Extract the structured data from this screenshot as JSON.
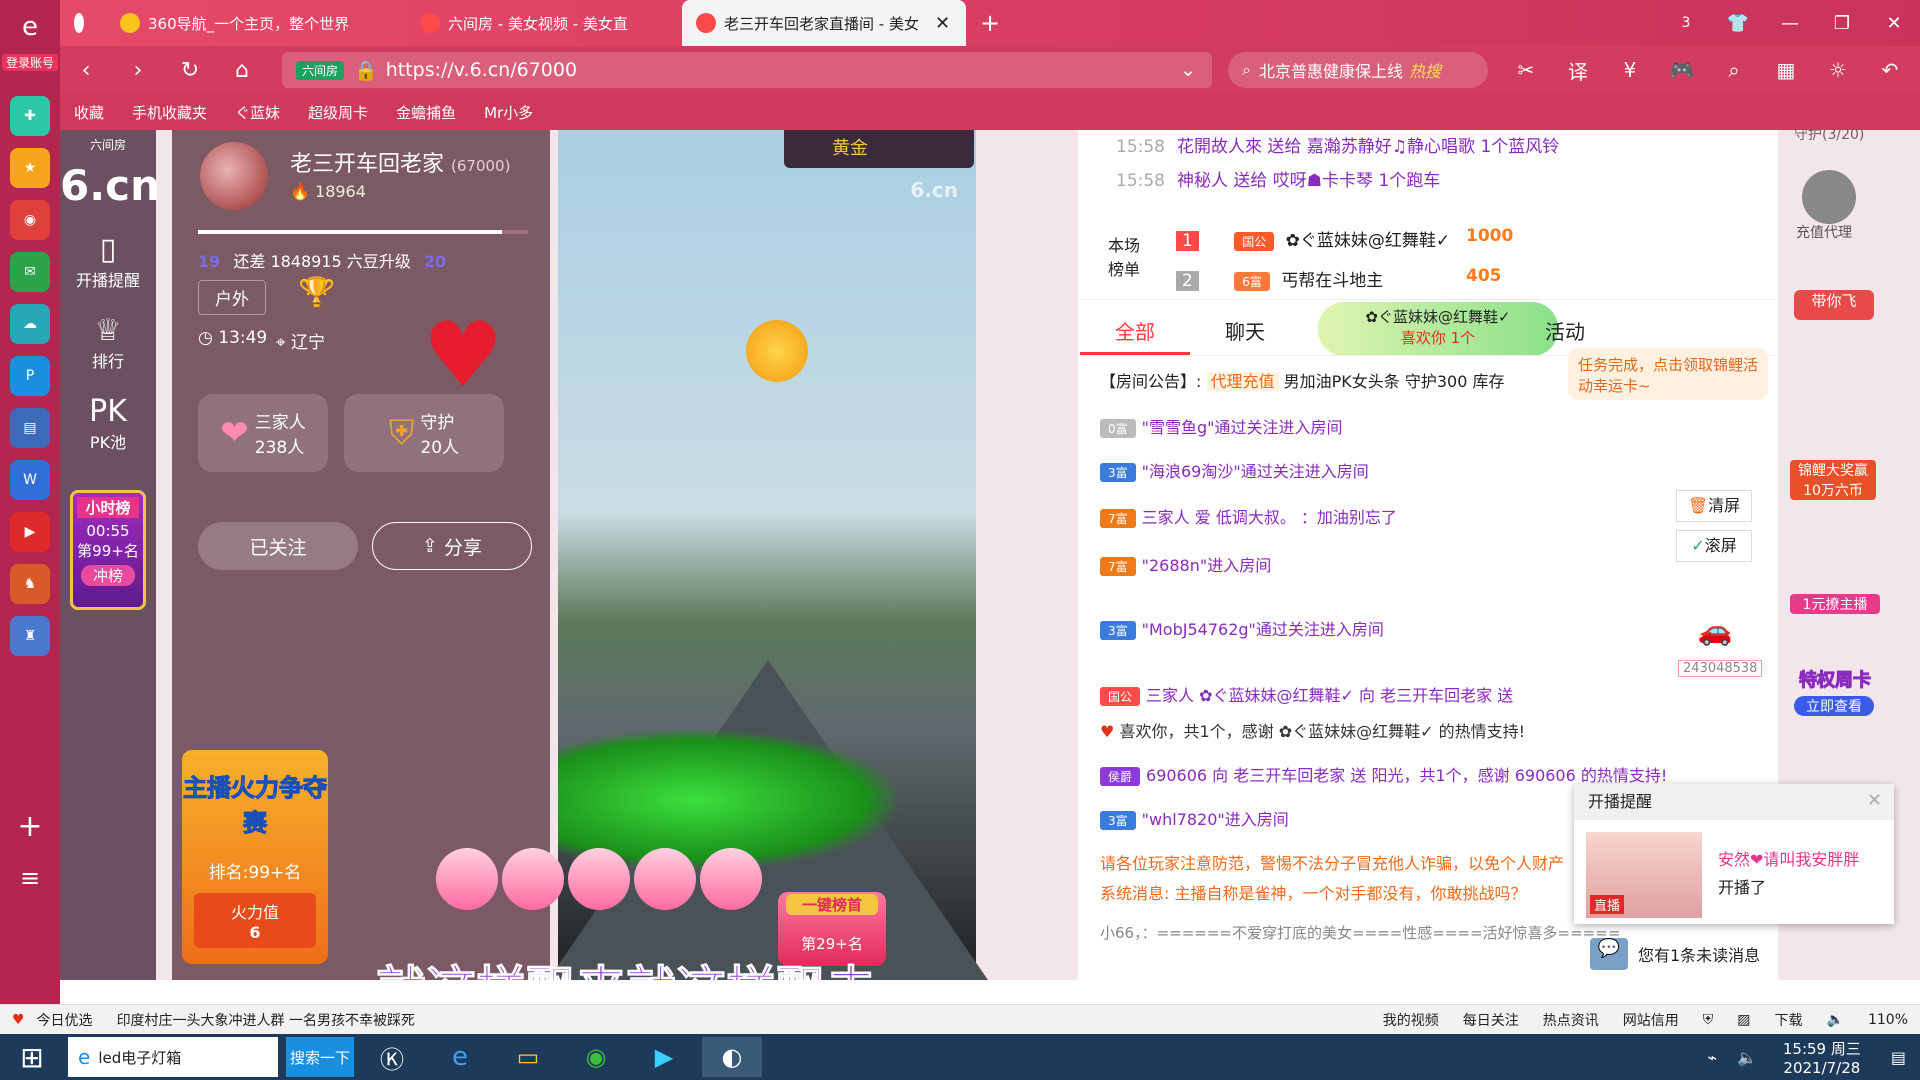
{
  "browser": {
    "login_label": "登录账号",
    "tabs": [
      {
        "label": "360导航_一个主页，整个世界"
      },
      {
        "label": "六间房 - 美女视频 - 美女直"
      },
      {
        "label": "老三开车回老家直播间 - 美女"
      }
    ],
    "tab_count": "3",
    "address": {
      "tag": "六间房",
      "url": "https://v.6.cn/67000"
    },
    "search": {
      "text": "北京普惠健康保上线",
      "hot": "热搜"
    },
    "bookmarks": [
      "收藏",
      "手机收藏夹",
      "ぐ蓝妹",
      "超级周卡",
      "金蟾捕鱼",
      "Mr小多"
    ]
  },
  "leftnav": {
    "brand": "六间房",
    "logo": "6.cn",
    "items": [
      "开播提醒",
      "排行",
      "PK池"
    ],
    "hour_rank": {
      "title": "小时榜",
      "time": "00:55",
      "rank": "第99+名",
      "cta": "冲榜"
    }
  },
  "anchor": {
    "name": "老三开车回老家",
    "room_id": "(67000)",
    "fans": "18964",
    "level_text": "还差 1848915 六豆升级",
    "level_from": "19",
    "level_to": "20",
    "level_progress": 0.92,
    "category": "户外",
    "time": "13:49",
    "location": "辽宁",
    "family": {
      "label": "三家人",
      "count": "238人"
    },
    "guard": {
      "label": "守护",
      "count": "20人"
    },
    "followed": "已关注",
    "share": "分享",
    "fire": {
      "title": "主播火力争夺赛",
      "rank": "排名:99+名",
      "value_label": "火力值",
      "value": "6"
    }
  },
  "video": {
    "watermark": "6.cn",
    "badge": "黄金",
    "subtitle": "就这样飘来就这样飘去",
    "topbox": "一键榜首",
    "topbox_rank": "第29+名"
  },
  "chat": {
    "top_msgs": [
      {
        "time": "15:58",
        "text": "花開故人來 送给 嘉瀚苏静好♫静心唱歌 1个蓝风铃"
      },
      {
        "time": "15:58",
        "text": "神秘人 送给 哎呀☗卡卡琴 1个跑车"
      }
    ],
    "rank_title": "本场榜单",
    "rank": [
      {
        "pos": "1",
        "badge": "国公",
        "name": "✿ぐ蓝妹妹@红舞鞋✓",
        "score": "1000"
      },
      {
        "pos": "2",
        "badge": "6富",
        "name": "丐帮在斗地主",
        "score": "405"
      }
    ],
    "like_pop": {
      "name": "✿ぐ蓝妹妹@红舞鞋✓",
      "text": "喜欢你 1个"
    },
    "tabs": [
      "全部",
      "聊天",
      "活动"
    ],
    "task_tip": "任务完成，点击领取锦鲤活动幸运卡~",
    "notice_label": "【房间公告】:",
    "notice_tag": "代理充值",
    "notice_text": "男加油PK女头条 守护300 库存",
    "clear_label": "清屏",
    "scroll_label": "滚屏",
    "messages": [
      {
        "badge": "0富",
        "text": "\"雪雪鱼g\"通过关注进入房间"
      },
      {
        "badge": "3富",
        "text": "\"海浪69淘沙\"通过关注进入房间"
      },
      {
        "badge": "7富",
        "text": "三家人 爱 低调大叔。 ：加油别忘了"
      },
      {
        "badge": "7富",
        "text": "\"2688n\"进入房间"
      },
      {
        "badge": "3富",
        "text": "\"MobJ54762g\"通过关注进入房间"
      },
      {
        "badge": "国公",
        "text": "三家人 ✿ぐ蓝妹妹@红舞鞋✓ 向 老三开车回老家 送"
      },
      {
        "badge": "",
        "text": "喜欢你，共1个，感谢 ✿ぐ蓝妹妹@红舞鞋✓ 的热情支持!"
      },
      {
        "badge": "侯爵",
        "text": "690606 向 老三开车回老家 送 阳光，共1个，感谢 690606 的热情支持!"
      },
      {
        "badge": "3富",
        "text": "\"whl7820\"进入房间"
      }
    ],
    "car_value": "243048538",
    "sys1": "请各位玩家注意防范，警惕不法分子冒充他人诈骗，以免个人财产",
    "sys2": "系统消息: 主播自称是雀神，一个对手都没有，你敢挑战吗？",
    "input_text": "小66，：======不爱穿打底的美女====性感====活好惊喜多======",
    "unread": "您有1条未读消息"
  },
  "rightside": {
    "guard_title": "守护(3/20)",
    "items": [
      "充值代理",
      "带你飞",
      "锦鲤大奖赢10万六币",
      "1元撩主播",
      "特权周卡",
      "立即查看"
    ]
  },
  "popup": {
    "title": "开播提醒",
    "name": "安然❤请叫我安胖胖",
    "text": "开播了",
    "live": "直播"
  },
  "statusbar": {
    "left": [
      "今日优选",
      "印度村庄一头大象冲进人群 一名男孩不幸被踩死"
    ],
    "right": [
      "我的视频",
      "每日关注",
      "热点资讯",
      "网站信用",
      "下载",
      "110%"
    ]
  },
  "taskbar": {
    "items": [
      "led电子灯箱",
      "搜索一下"
    ],
    "time": "15:59 周三",
    "date": "2021/7/28"
  }
}
